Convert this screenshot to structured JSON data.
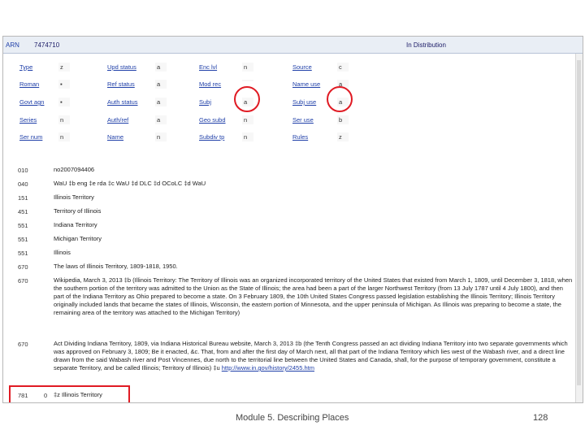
{
  "topbar": {
    "arn_label": "ARN",
    "arn_value": "7474710",
    "status": "In Distribution"
  },
  "fixed_fields": [
    [
      {
        "label": "Type",
        "value": "z"
      },
      {
        "label": "Upd status",
        "value": "a"
      },
      {
        "label": "Enc lvl",
        "value": "n"
      },
      {
        "label": "Source",
        "value": "c"
      }
    ],
    [
      {
        "label": "Roman",
        "value": "▪"
      },
      {
        "label": "Ref status",
        "value": "a"
      },
      {
        "label": "Mod rec",
        "value": ""
      },
      {
        "label": "Name use",
        "value": "a"
      }
    ],
    [
      {
        "label": "Govt agn",
        "value": "▪"
      },
      {
        "label": "Auth status",
        "value": "a"
      },
      {
        "label": "Subj",
        "value": "a"
      },
      {
        "label": "Subj use",
        "value": "a"
      }
    ],
    [
      {
        "label": "Series",
        "value": "n"
      },
      {
        "label": "Auth/ref",
        "value": "a"
      },
      {
        "label": "Geo subd",
        "value": "n"
      },
      {
        "label": "Ser use",
        "value": "b"
      }
    ],
    [
      {
        "label": "Ser num",
        "value": "n"
      },
      {
        "label": "Name",
        "value": "n"
      },
      {
        "label": "Subdiv tp",
        "value": "n"
      },
      {
        "label": "Rules",
        "value": "z"
      }
    ]
  ],
  "fields": [
    {
      "tag": "010",
      "ind": "",
      "text": "no2007094406"
    },
    {
      "tag": "040",
      "ind": "",
      "text": "WaU ‡b eng ‡e rda ‡c WaU ‡d DLC ‡d OCoLC ‡d WaU"
    },
    {
      "tag": "151",
      "ind": "",
      "text": "Illinois Territory"
    },
    {
      "tag": "451",
      "ind": "",
      "text": "Territory of Illinois"
    },
    {
      "tag": "551",
      "ind": "",
      "text": "Indiana Territory"
    },
    {
      "tag": "551",
      "ind": "",
      "text": "Michigan Territory"
    },
    {
      "tag": "551",
      "ind": "",
      "text": "Illinois"
    },
    {
      "tag": "670",
      "ind": "",
      "text": "The laws of Illinois Territory, 1809-1818, 1950."
    },
    {
      "tag": "670",
      "ind": "",
      "text": "Wikipedia, March 3, 2013 ‡b (Illinois Territory: The Territory of Illinois was an organized incorporated territory of the United States that existed from March 1, 1809, until December 3, 1818, when the southern portion of the territory was admitted to the Union as the State of Illinois; the area had been a part of the larger Northwest Territory (from 13 July 1787 until 4 July 1800), and then part of the Indiana Territory as Ohio prepared to become a state. On 3 February 1809, the 10th United States Congress passed legislation establishing the Illinois Territory; Illinois Territory originally included lands that became the states of Illinois, Wisconsin, the eastern portion of Minnesota, and the upper peninsula of Michigan. As Illinois was preparing to become a state, the remaining area of the territory was attached to the Michigan Territory)"
    },
    {
      "tag": "670",
      "ind": "",
      "text": "Act Dividing Indiana Territory, 1809, via Indiana Historical Bureau website, March 3, 2013 ‡b (the Tenth Congress passed an act dividing Indiana Territory into two separate governments which was approved on February 3, 1809; Be it enacted, &c. That, from and after the first day of March next, all that part of the Indiana Territory which lies west of the Wabash river, and a direct line drawn from the said Wabash river and Post Vincennes, due north to the territorial line between the United States and Canada, shall, for the purpose of temporary government, constitute a separate Territory, and be called Illinois; Territory of Illinois) ‡u ",
      "link": "http://www.in.gov/history/2455.htm"
    },
    {
      "tag": "781",
      "ind": "0",
      "text": "‡z Illinois Territory"
    }
  ],
  "footer": {
    "module": "Module 5. Describing Places",
    "page": "128"
  },
  "colors": {
    "highlight": "#e01b24",
    "link": "#1f3fa8"
  }
}
